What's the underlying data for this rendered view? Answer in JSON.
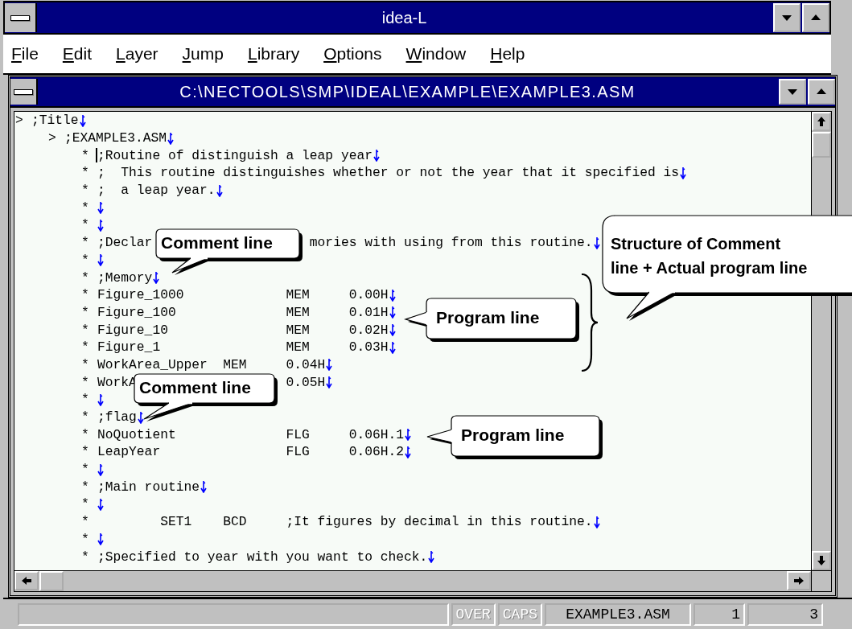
{
  "window": {
    "title": "idea-L"
  },
  "menu": [
    "File",
    "Edit",
    "Layer",
    "Jump",
    "Library",
    "Options",
    "Window",
    "Help"
  ],
  "document": {
    "title": "C:\\NECTOOLS\\SMP\\IDEAL\\EXAMPLE\\EXAMPLE3.ASM",
    "lines": [
      {
        "marker": ">",
        "text": ";Title",
        "eol": true,
        "children": [
          {
            "marker": ">",
            "text": ";EXAMPLE3.ASM",
            "eol": true,
            "children": [
              {
                "marker": "*",
                "text": ";Routine of distinguish a leap year",
                "eol": true,
                "cursor": true
              },
              {
                "marker": "*",
                "text": ";  This routine distinguishes whether or not the year that it specified is",
                "eol": true
              },
              {
                "marker": "*",
                "text": ";  a leap year.",
                "eol": true
              },
              {
                "marker": "*",
                "eol": true
              },
              {
                "marker": "*",
                "eol": true
              },
              {
                "marker": "*",
                "text": ";Declar",
                "text_after_callout": "                    mories with using from this routine.",
                "eol": true
              },
              {
                "marker": "*",
                "eol": true
              },
              {
                "marker": "*",
                "text": ";Memory",
                "eol": true
              },
              {
                "marker": "*",
                "text": "Figure_1000             MEM     0.00H",
                "eol": true
              },
              {
                "marker": "*",
                "text": "Figure_100              MEM     0.01H",
                "eol": true
              },
              {
                "marker": "*",
                "text": "Figure_10               MEM     0.02H",
                "eol": true
              },
              {
                "marker": "*",
                "text": "Figure_1                MEM     0.03H",
                "eol": true
              },
              {
                "marker": "*",
                "text": "WorkArea_Upper  MEM     0.04H",
                "eol": true
              },
              {
                "marker": "*",
                "text": "WorkA",
                "text_after_callout": "                   0.05H",
                "eol": true
              },
              {
                "marker": "*",
                "eol": true
              },
              {
                "marker": "*",
                "text": ";flag",
                "eol": true
              },
              {
                "marker": "*",
                "text": "NoQuotient              FLG     0.06H.1",
                "eol": true
              },
              {
                "marker": "*",
                "text": "LeapYear                FLG     0.06H.2",
                "eol": true
              },
              {
                "marker": "*",
                "eol": true
              },
              {
                "marker": "*",
                "text": ";Main routine",
                "eol": true
              },
              {
                "marker": "*",
                "eol": true
              },
              {
                "marker": "*",
                "text": "        SET1    BCD     ;It figures by decimal in this routine.",
                "eol": true
              },
              {
                "marker": "*",
                "eol": true
              },
              {
                "marker": "*",
                "text": ";Specified to year with you want to check.",
                "eol": true
              }
            ]
          }
        ]
      }
    ]
  },
  "callouts": [
    {
      "lines": [
        "Comment line"
      ]
    },
    {
      "lines": [
        "Comment line"
      ]
    },
    {
      "lines": [
        "Program line"
      ]
    },
    {
      "lines": [
        "Program line"
      ]
    },
    {
      "lines": [
        "Structure of Comment",
        "line + Actual program line"
      ]
    }
  ],
  "status_bar": {
    "indicators": [
      {
        "label": "OVER",
        "on": false
      },
      {
        "label": "CAPS",
        "on": false
      }
    ],
    "fields": [
      "EXAMPLE3.ASM",
      "1",
      "3"
    ]
  }
}
